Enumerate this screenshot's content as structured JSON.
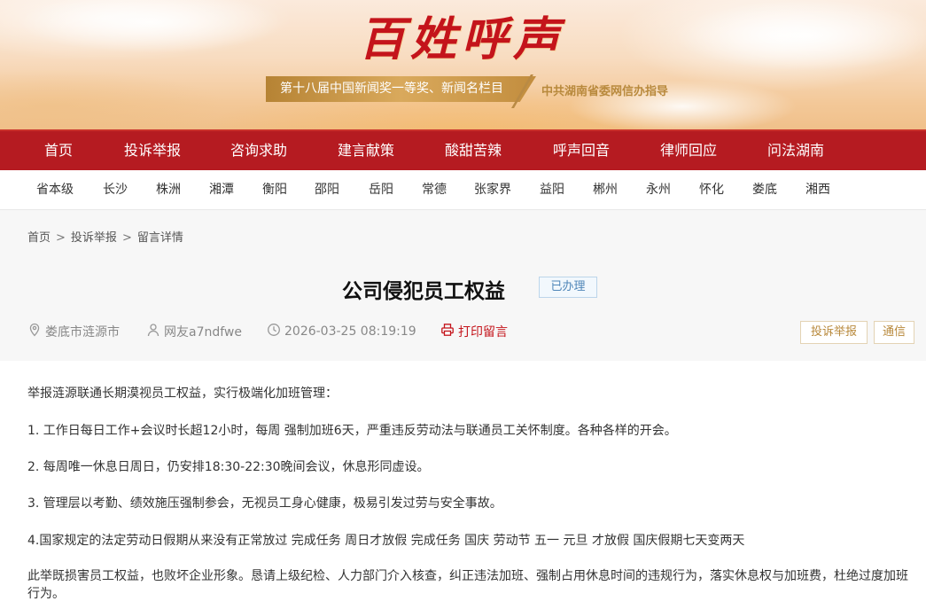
{
  "banner": {
    "title": "百姓呼声",
    "award": "第十八届中国新闻奖一等奖、新闻名栏目",
    "guide": "中共湖南省委网信办指导"
  },
  "main_nav": [
    "首页",
    "投诉举报",
    "咨询求助",
    "建言献策",
    "酸甜苦辣",
    "呼声回音",
    "律师回应",
    "问法湖南"
  ],
  "sub_nav": [
    "省本级",
    "长沙",
    "株洲",
    "湘潭",
    "衡阳",
    "邵阳",
    "岳阳",
    "常德",
    "张家界",
    "益阳",
    "郴州",
    "永州",
    "怀化",
    "娄底",
    "湘西"
  ],
  "breadcrumb": [
    "首页",
    "投诉举报",
    "留言详情"
  ],
  "breadcrumb_sep": ">",
  "message": {
    "title": "公司侵犯员工权益",
    "status": "已办理",
    "location": "娄底市涟源市",
    "user": "网友a7ndfwe",
    "time": "2026-03-25 08:19:19",
    "print": "打印留言",
    "category": "投诉举报",
    "type": "通信"
  },
  "content": [
    "举报涟源联通长期漠视员工权益，实行极端化加班管理：",
    "1. 工作日每日工作+会议时长超12小时，每周 强制加班6天，严重违反劳动法与联通员工关怀制度。各种各样的开会。",
    "2. 每周唯一休息日周日，仍安排18:30-22:30晚间会议，休息形同虚设。",
    "3. 管理层以考勤、绩效施压强制参会，无视员工身心健康，极易引发过劳与安全事故。",
    "4.国家规定的法定劳动日假期从来没有正常放过 完成任务 周日才放假  完成任务  国庆  劳动节  五一  元旦  才放假  国庆假期七天变两天",
    "此举既损害员工权益，也败坏企业形象。恳请上级纪检、人力部门介入核查，纠正违法加班、强制占用休息时间的违规行为，落实休息权与加班费，杜绝过度加班行为。"
  ],
  "colors": {
    "brand_red": "#b51b21",
    "gold": "#b8893c",
    "status_blue": "#4f86b8"
  },
  "icons": [
    "location-icon",
    "user-icon",
    "clock-icon",
    "printer-icon"
  ]
}
